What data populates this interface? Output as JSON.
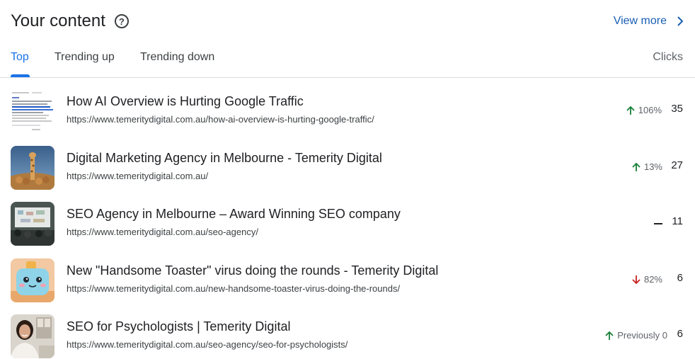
{
  "header": {
    "title": "Your content",
    "help_icon": "help-circle-icon",
    "view_more_label": "View more",
    "view_more_icon": "chevron-right-icon"
  },
  "tabs": [
    {
      "label": "Top",
      "active": true
    },
    {
      "label": "Trending up",
      "active": false
    },
    {
      "label": "Trending down",
      "active": false
    }
  ],
  "columns": {
    "clicks": "Clicks"
  },
  "colors": {
    "accent": "#1a73e8",
    "up": "#188038",
    "down": "#c5221f",
    "link": "#1a5fb4"
  },
  "rows": [
    {
      "title": "How AI Overview is Hurting Google Traffic",
      "url": "https://www.temeritydigital.com.au/how-ai-overview-is-hurting-google-traffic/",
      "trend": "106%",
      "trend_dir": "up",
      "clicks": "35"
    },
    {
      "title": "Digital Marketing Agency in Melbourne - Temerity Digital",
      "url": "https://www.temeritydigital.com.au/",
      "trend": "13%",
      "trend_dir": "up",
      "clicks": "27"
    },
    {
      "title": "SEO Agency in Melbourne – Award Winning SEO company",
      "url": "https://www.temeritydigital.com.au/seo-agency/",
      "trend": "",
      "trend_dir": "flat",
      "clicks": "11"
    },
    {
      "title": "New \"Handsome Toaster\" virus doing the rounds - Temerity Digital",
      "url": "https://www.temeritydigital.com.au/new-handsome-toaster-virus-doing-the-rounds/",
      "trend": "82%",
      "trend_dir": "down",
      "clicks": "6"
    },
    {
      "title": "SEO for Psychologists | Temerity Digital",
      "url": "https://www.temeritydigital.com.au/seo-agency/seo-for-psychologists/",
      "trend": "Previously 0",
      "trend_dir": "up",
      "clicks": "6"
    }
  ]
}
